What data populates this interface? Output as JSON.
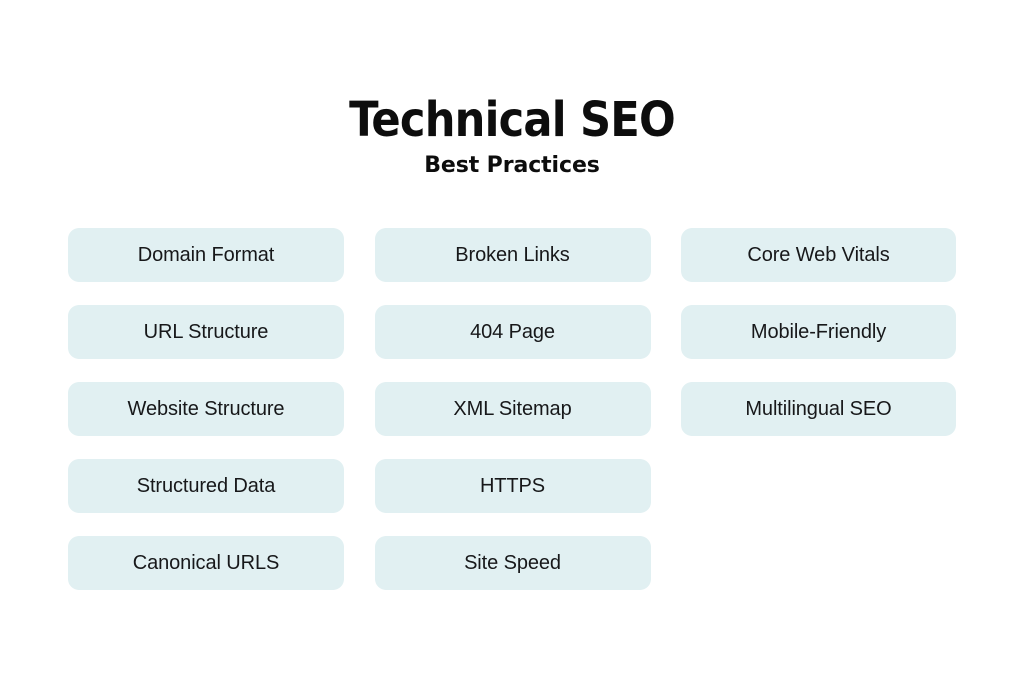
{
  "header": {
    "title": "Technical SEO",
    "subtitle": "Best Practices"
  },
  "theme": {
    "background": "#ffffff",
    "pill_background": "#e1f0f2",
    "text_color": "#17181a",
    "heading_color": "#0d0d0d"
  },
  "columns": [
    {
      "name": "left",
      "items": [
        {
          "label": "Domain Format"
        },
        {
          "label": "URL Structure"
        },
        {
          "label": "Website Structure"
        },
        {
          "label": "Structured Data"
        },
        {
          "label": "Canonical URLS"
        }
      ]
    },
    {
      "name": "middle",
      "items": [
        {
          "label": "Broken Links"
        },
        {
          "label": "404 Page"
        },
        {
          "label": "XML Sitemap"
        },
        {
          "label": "HTTPS"
        },
        {
          "label": "Site Speed"
        }
      ]
    },
    {
      "name": "right",
      "items": [
        {
          "label": "Core Web Vitals"
        },
        {
          "label": "Mobile-Friendly"
        },
        {
          "label": "Multilingual SEO"
        }
      ]
    }
  ]
}
